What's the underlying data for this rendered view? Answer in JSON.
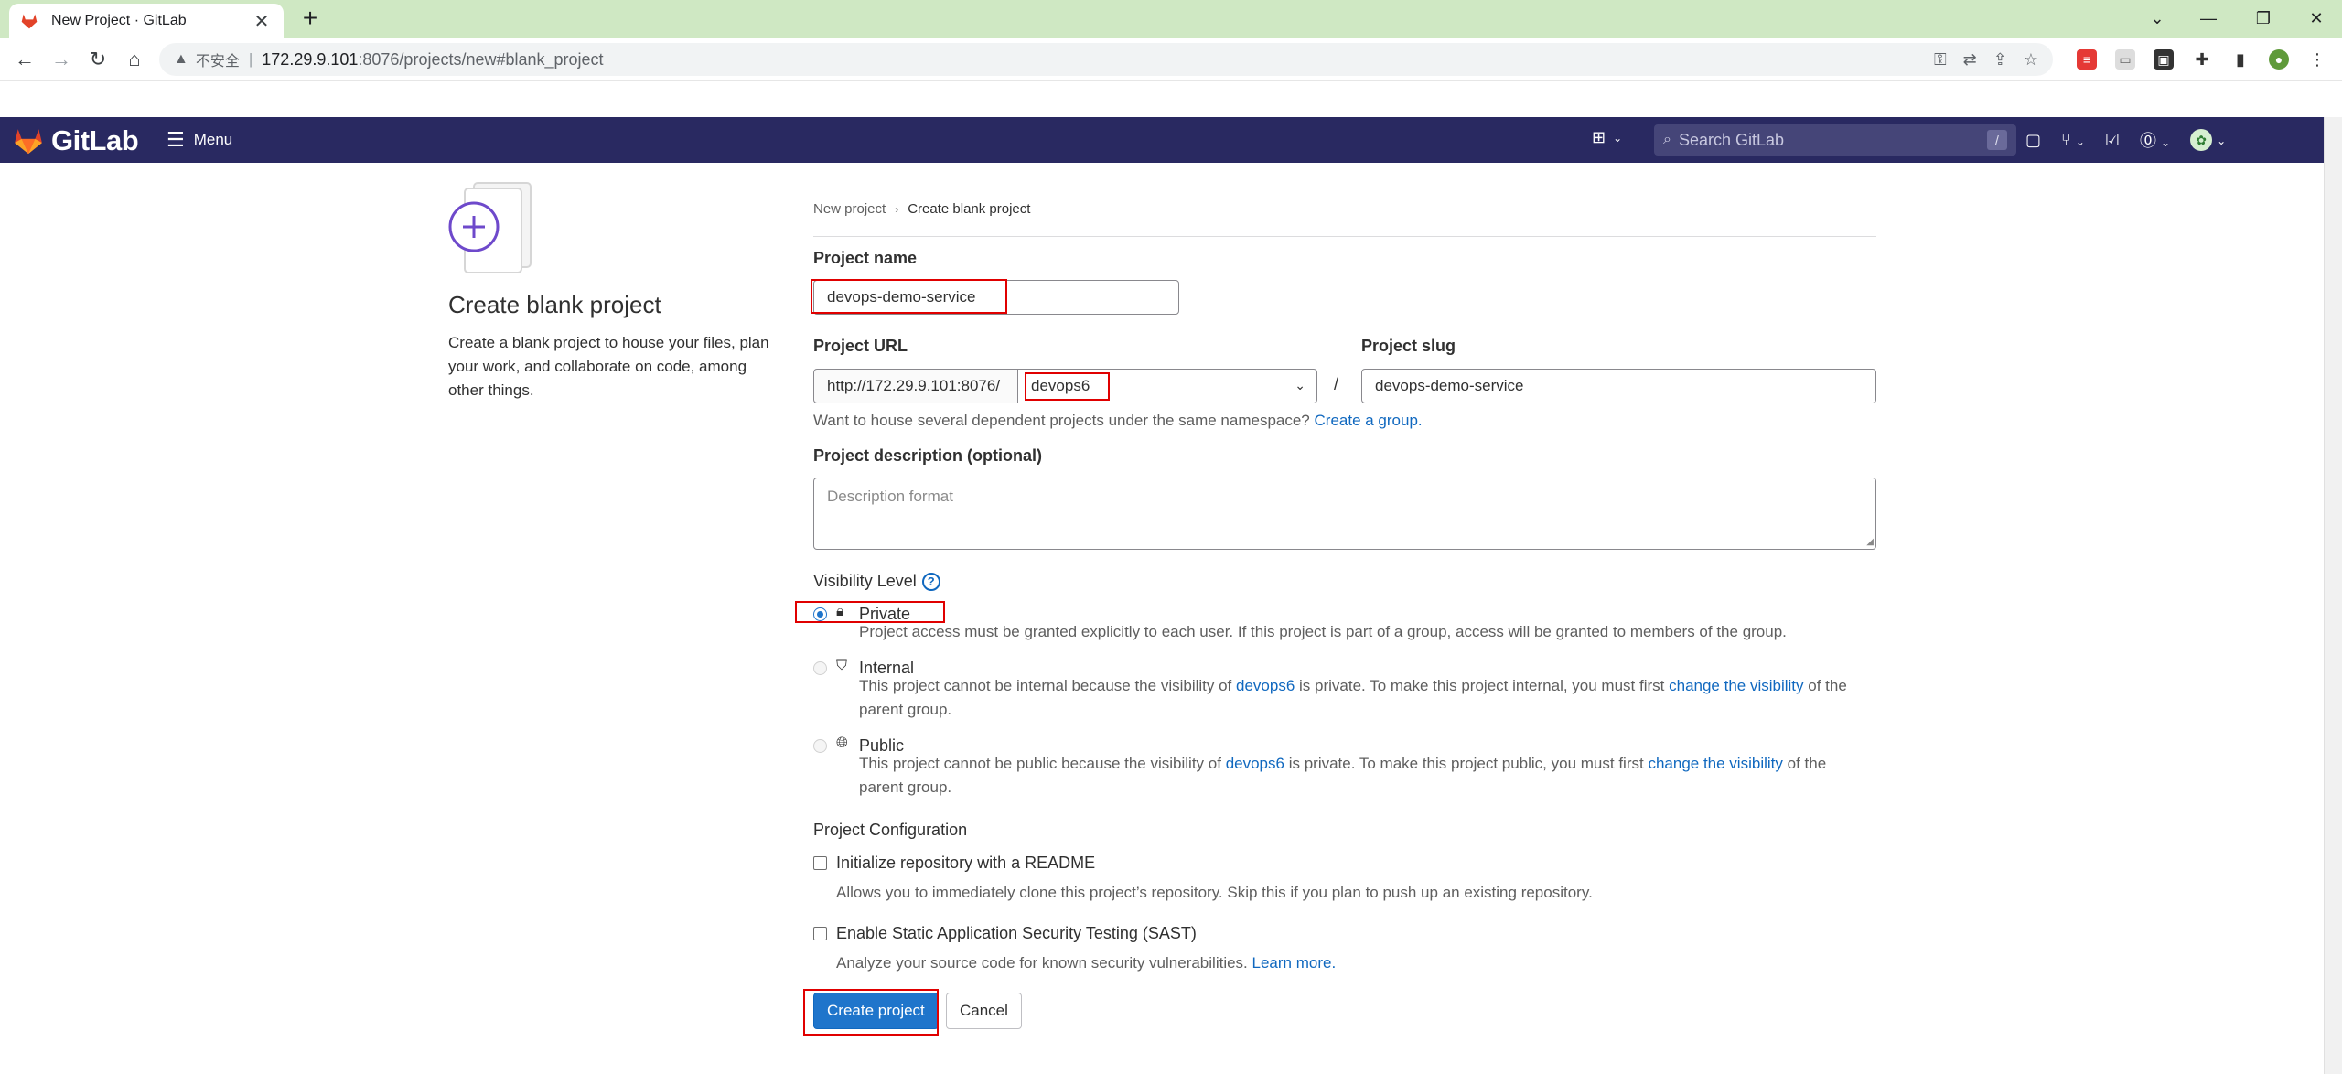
{
  "browser": {
    "tab_title": "New Project · GitLab",
    "tab_close": "✕",
    "new_tab": "+",
    "address_insecure": "不安全",
    "address_host": "172.29.9.101",
    "address_path": ":8076/projects/new#blank_project",
    "window_controls": [
      "⌄",
      "—",
      "❐",
      "✕"
    ]
  },
  "gitlab_header": {
    "logo_text": "GitLab",
    "menu_label": "Menu",
    "search_placeholder": "Search GitLab",
    "search_shortcut": "/"
  },
  "left": {
    "title": "Create blank project",
    "description": "Create a blank project to house your files, plan your work, and collaborate on code, among other things."
  },
  "breadcrumb": {
    "parent": "New project",
    "current": "Create blank project"
  },
  "form": {
    "project_name_label": "Project name",
    "project_name_value": "devops-demo-service",
    "project_url_label": "Project URL",
    "url_prefix": "http://172.29.9.101:8076/",
    "namespace_value": "devops6",
    "slash": "/",
    "project_slug_label": "Project slug",
    "project_slug_value": "devops-demo-service",
    "namespace_help": "Want to house several dependent projects under the same namespace?",
    "namespace_help_link": "Create a group.",
    "description_label": "Project description (optional)",
    "description_placeholder": "Description format",
    "visibility_label": "Visibility Level",
    "visibility_help": "?",
    "visibility": [
      {
        "title": "Private",
        "desc": "Project access must be granted explicitly to each user. If this project is part of a group, access will be granted to members of the group."
      },
      {
        "title": "Internal",
        "desc_a": "This project cannot be internal because the visibility of",
        "desc_link1": "devops6",
        "desc_b": "is private. To make this project internal, you must first",
        "desc_link2": "change the visibility",
        "desc_c": "of the parent group."
      },
      {
        "title": "Public",
        "desc_a": "This project cannot be public because the visibility of",
        "desc_link1": "devops6",
        "desc_b": "is private. To make this project public, you must first",
        "desc_link2": "change the visibility",
        "desc_c": "of the parent group."
      }
    ],
    "config_label": "Project Configuration",
    "readme_title": "Initialize repository with a README",
    "readme_desc": "Allows you to immediately clone this project’s repository. Skip this if you plan to push up an existing repository.",
    "sast_title": "Enable Static Application Security Testing (SAST)",
    "sast_desc": "Analyze your source code for known security vulnerabilities.",
    "sast_link": "Learn more.",
    "create_button": "Create project",
    "cancel_button": "Cancel"
  },
  "colors": {
    "header_bg": "#292961",
    "primary": "#1f75cb",
    "link": "#1068bf",
    "highlight": "#e00000",
    "tabstrip": "#cfe8c3"
  }
}
